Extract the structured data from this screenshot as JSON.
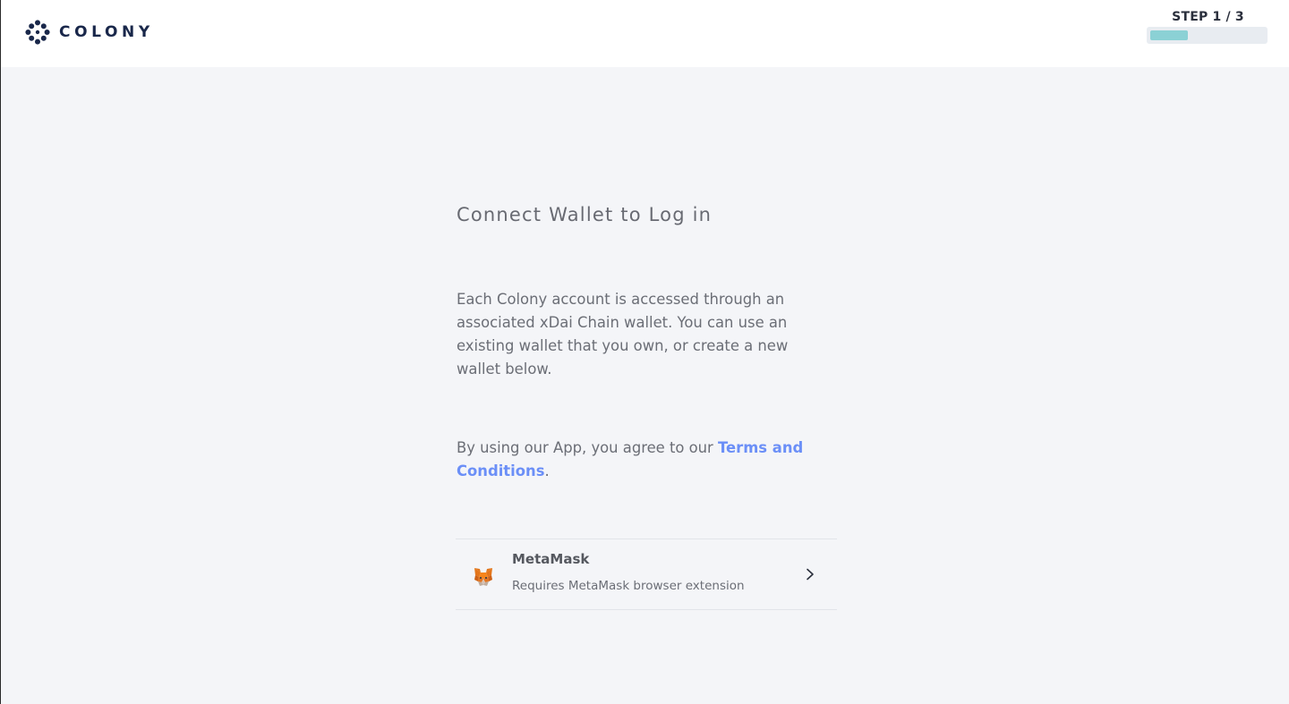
{
  "header": {
    "brand": "COLONY",
    "step_label": "STEP 1 / 3",
    "progress": 0.33
  },
  "main": {
    "title": "Connect Wallet to Log in",
    "description": "Each Colony account is accessed through an associated xDai Chain wallet. You can use an existing wallet that you own, or create a new wallet below.",
    "terms_prefix": "By using our App, you agree to our ",
    "terms_link": "Terms and Conditions",
    "terms_suffix": "."
  },
  "wallets": [
    {
      "name": "MetaMask",
      "subtitle": "Requires MetaMask browser extension",
      "icon": "metamask-fox-icon"
    }
  ],
  "colors": {
    "brand_navy": "#19274a",
    "link_blue": "#6b8ff7",
    "progress_teal": "#8bd1d5",
    "background": "#f4f5f8"
  }
}
